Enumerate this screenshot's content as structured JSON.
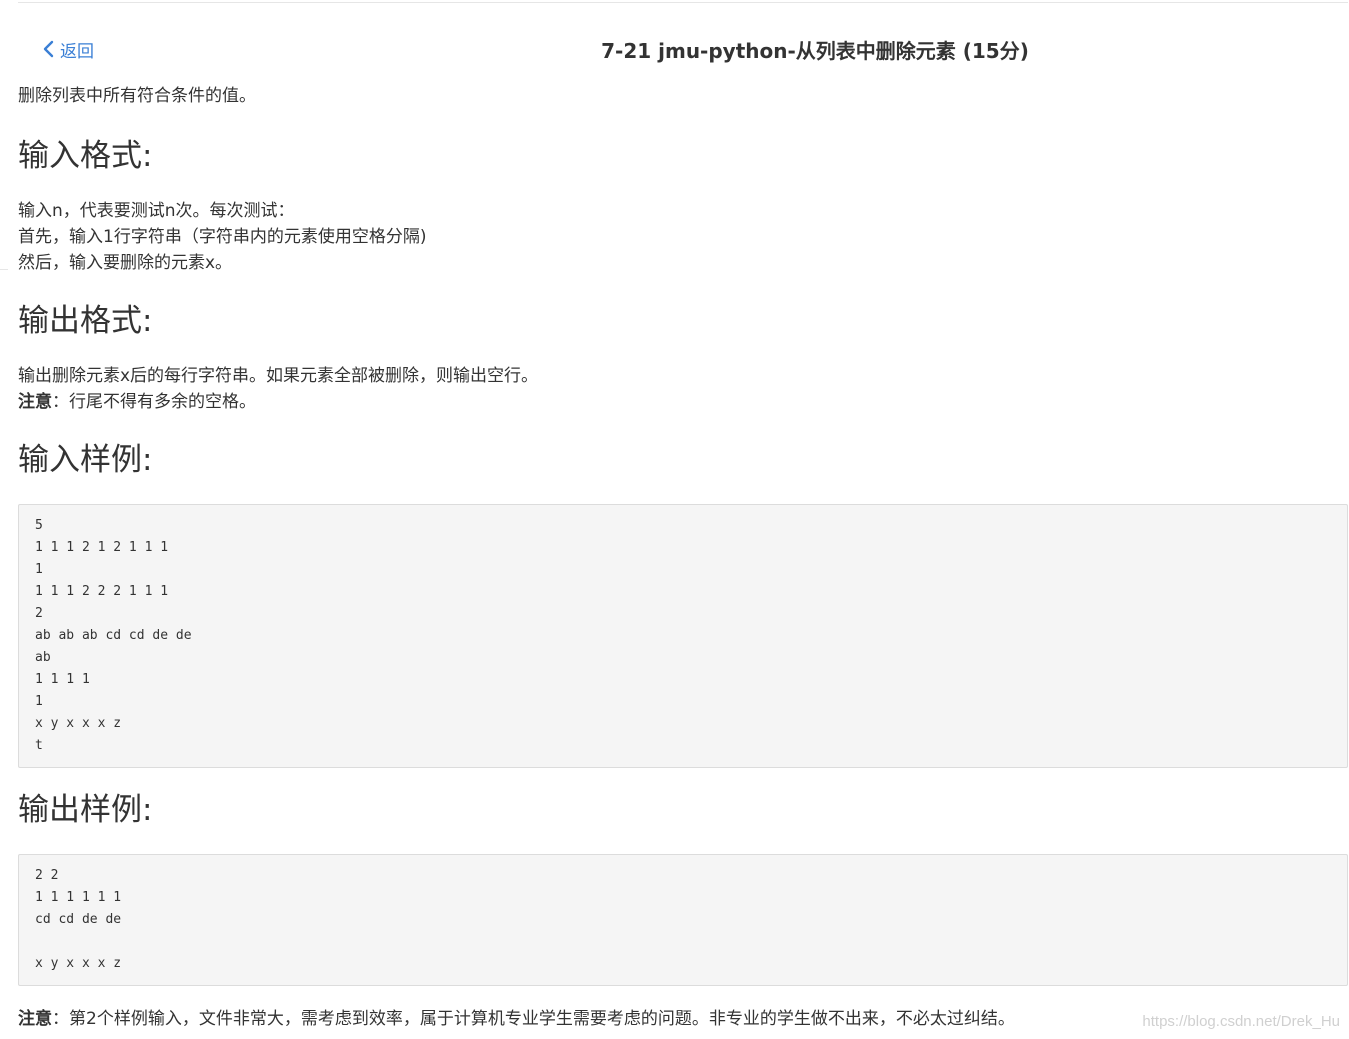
{
  "header": {
    "back_label": "返回",
    "title": "7-21 jmu-python-从列表中删除元素 (15分)"
  },
  "description": "删除列表中所有符合条件的值。",
  "input_format": {
    "heading": "输入格式:",
    "lines": [
      "输入n，代表要测试n次。每次测试：",
      "首先，输入1行字符串（字符串内的元素使用空格分隔)",
      "然后，输入要删除的元素x。"
    ]
  },
  "output_format": {
    "heading": "输出格式:",
    "line": "输出删除元素x后的每行字符串。如果元素全部被删除，则输出空行。",
    "note_label": "注意",
    "note_text": "：行尾不得有多余的空格。"
  },
  "sample_input": {
    "heading": "输入样例:",
    "lines": [
      "5",
      "1 1 1 2 1 2 1 1 1",
      "1",
      "1 1 1 2 2 2 1 1 1",
      "2",
      "ab ab ab cd cd de de",
      "ab",
      "1 1 1 1",
      "1",
      "x y x x x z",
      "t"
    ]
  },
  "sample_output": {
    "heading": "输出样例:",
    "lines": [
      "2 2",
      "1 1 1 1 1 1",
      "cd cd de de",
      "",
      "x y x x x z"
    ]
  },
  "footer_note": {
    "label": "注意",
    "text": "：第2个样例输入，文件非常大，需考虑到效率，属于计算机专业学生需要考虑的问题。非专业的学生做不出来，不必太过纠结。"
  },
  "watermark": "https://blog.csdn.net/Drek_Hu",
  "colors": {
    "link": "#3a7fd5",
    "text": "#333333",
    "code_bg": "#f5f5f5",
    "code_border": "#dcdcdc"
  },
  "icons": {
    "back": "chevron-left-icon"
  }
}
